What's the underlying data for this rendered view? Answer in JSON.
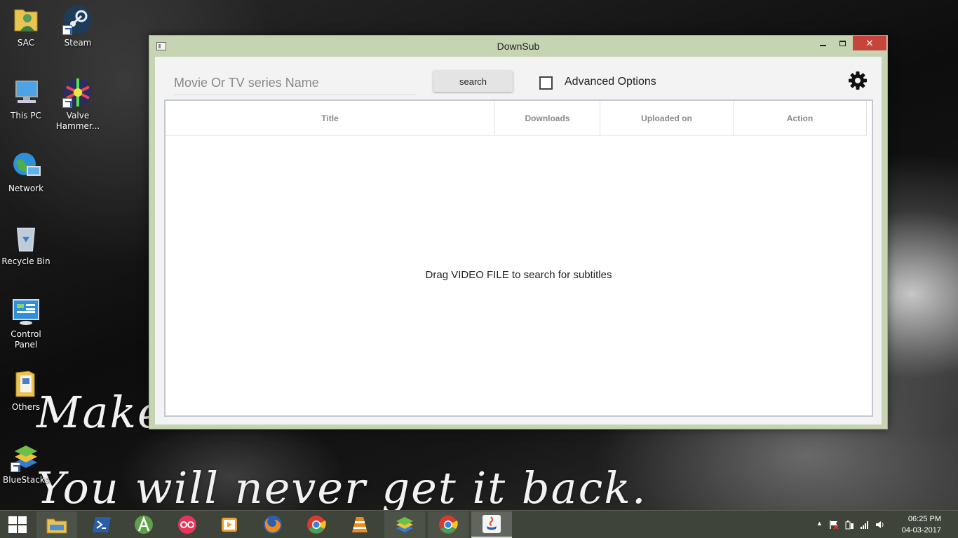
{
  "desktop": {
    "icons": [
      {
        "label": "SAC",
        "icon": "user-folder-icon"
      },
      {
        "label": "Steam",
        "icon": "steam-icon"
      },
      {
        "label": "This PC",
        "icon": "computer-icon"
      },
      {
        "label": "Valve Hammer...",
        "icon": "hammer-editor-icon"
      },
      {
        "label": "Network",
        "icon": "network-globe-icon"
      },
      {
        "label": "Recycle Bin",
        "icon": "recycle-bin-icon"
      },
      {
        "label": "Control Panel",
        "icon": "control-panel-icon"
      },
      {
        "label": "Others",
        "icon": "folder-icon"
      },
      {
        "label": "BlueStacks",
        "icon": "bluestacks-icon"
      }
    ],
    "wallpaper_text": {
      "line1": "Make",
      "line2": "You  will never get it back."
    }
  },
  "window": {
    "title": "DownSub",
    "controls": {
      "minimize": "minimize",
      "maximize": "maximize",
      "close": "✕"
    },
    "search": {
      "placeholder": "Movie Or TV series Name",
      "button_label": "search"
    },
    "advanced_options": {
      "label": "Advanced Options",
      "checked": false
    },
    "settings_icon": "gear-icon",
    "table": {
      "columns": [
        "Title",
        "Downloads",
        "Uploaded on",
        "Action"
      ],
      "rows": [],
      "empty_message": "Drag VIDEO FILE to search for subtitles"
    }
  },
  "taskbar": {
    "items": [
      {
        "icon": "file-explorer-icon",
        "state": "pinned"
      },
      {
        "icon": "powershell-icon",
        "state": "normal"
      },
      {
        "icon": "android-studio-icon",
        "state": "normal"
      },
      {
        "icon": "flickr-icon",
        "state": "normal"
      },
      {
        "icon": "media-player-icon",
        "state": "normal"
      },
      {
        "icon": "firefox-icon",
        "state": "normal"
      },
      {
        "icon": "chrome-icon",
        "state": "normal"
      },
      {
        "icon": "vlc-icon",
        "state": "normal"
      },
      {
        "icon": "bluestacks-icon",
        "state": "pinned"
      },
      {
        "icon": "chrome-icon",
        "state": "pinned"
      },
      {
        "icon": "java-icon",
        "state": "active"
      }
    ],
    "tray": {
      "time": "06:25 PM",
      "date": "04-03-2017"
    }
  },
  "colors": {
    "window_frame": "#c6d4b3",
    "close_button": "#c7443a",
    "taskbar": "#3e443a"
  }
}
